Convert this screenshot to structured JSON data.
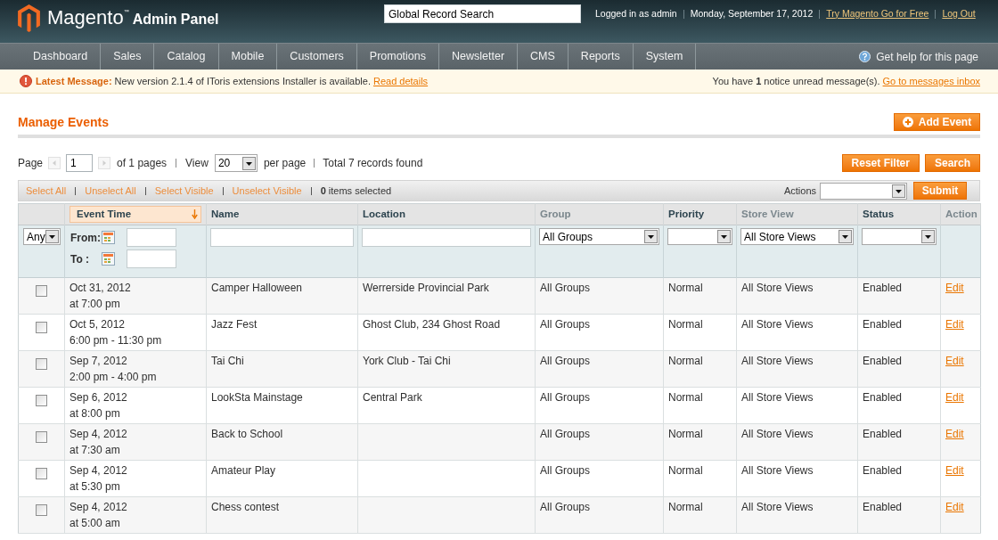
{
  "header": {
    "logo": {
      "name": "Magento",
      "trademark": "™",
      "subtitle": "Admin Panel"
    },
    "search": {
      "value": "Global Record Search"
    },
    "account": [
      {
        "kind": "text",
        "label": "Logged in as admin"
      },
      {
        "kind": "text",
        "label": "Monday, September 17, 2012"
      },
      {
        "kind": "link",
        "label": "Try Magento Go for Free"
      },
      {
        "kind": "link",
        "label": "Log Out"
      }
    ]
  },
  "nav": {
    "items": [
      "Dashboard",
      "Sales",
      "Catalog",
      "Mobile",
      "Customers",
      "Promotions",
      "Newsletter",
      "CMS",
      "Reports",
      "System"
    ],
    "help": "Get help for this page"
  },
  "message": {
    "label": "Latest Message:",
    "text": "New version 2.1.4 of IToris extensions Installer is available.",
    "link": "Read details",
    "notice": "You have **1** notice unread message(s).",
    "inbox_link": "Go to messages inbox"
  },
  "page": {
    "title": "Manage Events",
    "add_button": "Add Event"
  },
  "pager": {
    "page_label": "Page",
    "previous": {
      "disabled": true
    },
    "page": "1",
    "next": {
      "disabled": true
    },
    "of_pages": "of 1 pages",
    "view_label": "View",
    "per_page": "20",
    "per_page_label": "per page",
    "total": "Total 7 records found",
    "buttons": [
      "Reset Filter",
      "Search"
    ]
  },
  "massaction": {
    "links": [
      "Select All",
      "Unselect All",
      "Select Visible",
      "Unselect Visible"
    ],
    "selected": "**0** items selected",
    "actions_label": "Actions",
    "submit": "Submit"
  },
  "grid": {
    "columns": [
      {
        "filter": {
          "kind": "select",
          "value": "Any"
        }
      },
      {
        "label": "Event Time",
        "sortable": true,
        "sorted": true,
        "filter": {
          "kind": "date_range",
          "from_label": "From:",
          "to_label": "To :"
        }
      },
      {
        "label": "Name",
        "sortable": true,
        "sorted": false,
        "filter": {
          "kind": "text"
        }
      },
      {
        "label": "Location",
        "sortable": true,
        "sorted": false,
        "filter": {
          "kind": "text"
        }
      },
      {
        "label": "Group",
        "sortable": false,
        "sorted": false,
        "filter": {
          "kind": "select",
          "value": "All Groups"
        }
      },
      {
        "label": "Priority",
        "sortable": true,
        "sorted": false,
        "filter": {
          "kind": "select"
        }
      },
      {
        "label": "Store View",
        "sortable": false,
        "sorted": false,
        "filter": {
          "kind": "select",
          "value": "All Store Views"
        }
      },
      {
        "label": "Status",
        "sortable": true,
        "sorted": false,
        "filter": {
          "kind": "select"
        }
      },
      {
        "label": "Action",
        "sortable": false,
        "sorted": false
      }
    ],
    "rows": [
      {
        "checked": false,
        "date": "Oct 31, 2012",
        "time": "at 7:00 pm",
        "name": "Camper Halloween",
        "location": "Werrerside Provincial Park",
        "group": "All Groups",
        "priority": "Normal",
        "store_view": "All Store Views",
        "status": "Enabled",
        "action": "Edit"
      },
      {
        "checked": false,
        "date": "Oct 5, 2012",
        "time": "6:00 pm - 11:30 pm",
        "name": "Jazz Fest",
        "location": "Ghost Club, 234 Ghost Road",
        "group": "All Groups",
        "priority": "Normal",
        "store_view": "All Store Views",
        "status": "Enabled",
        "action": "Edit"
      },
      {
        "checked": false,
        "date": "Sep 7, 2012",
        "time": "2:00 pm - 4:00 pm",
        "name": "Tai Chi",
        "location": "York Club - Tai Chi",
        "group": "All Groups",
        "priority": "Normal",
        "store_view": "All Store Views",
        "status": "Enabled",
        "action": "Edit"
      },
      {
        "checked": false,
        "date": "Sep 6, 2012",
        "time": "at 8:00 pm",
        "name": "LookSta Mainstage",
        "location": "Central Park",
        "group": "All Groups",
        "priority": "Normal",
        "store_view": "All Store Views",
        "status": "Enabled",
        "action": "Edit"
      },
      {
        "checked": false,
        "date": "Sep 4, 2012",
        "time": "at 7:30 am",
        "name": "Back to School",
        "group": "All Groups",
        "priority": "Normal",
        "store_view": "All Store Views",
        "status": "Enabled",
        "action": "Edit"
      },
      {
        "checked": false,
        "date": "Sep 4, 2012",
        "time": "at 5:30 pm",
        "name": "Amateur Play",
        "group": "All Groups",
        "priority": "Normal",
        "store_view": "All Store Views",
        "status": "Enabled",
        "action": "Edit"
      },
      {
        "checked": false,
        "date": "Sep 4, 2012",
        "time": "at 5:00 am",
        "name": "Chess contest",
        "group": "All Groups",
        "priority": "Normal",
        "store_view": "All Store Views",
        "status": "Enabled",
        "action": "Edit"
      }
    ]
  }
}
